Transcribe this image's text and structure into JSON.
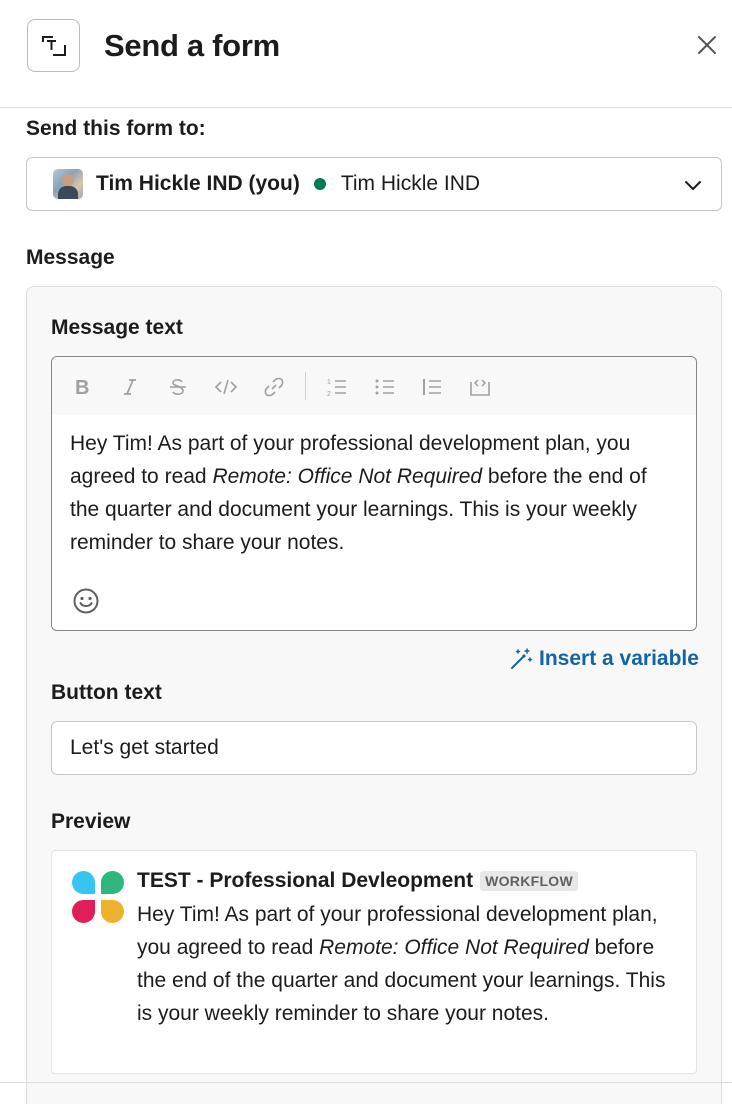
{
  "header": {
    "title": "Send a form",
    "icon": "form-icon",
    "close_icon": "close-icon"
  },
  "recipient": {
    "label": "Send this form to:",
    "name": "Tim Hickle IND (you)",
    "alt_name": "Tim Hickle IND",
    "presence_color": "#007a5a"
  },
  "message": {
    "section_label": "Message",
    "text_label": "Message text",
    "toolbar": [
      "bold-icon",
      "italic-icon",
      "strikethrough-icon",
      "code-icon",
      "link-icon",
      "ordered-list-icon",
      "bulleted-list-icon",
      "quote-icon",
      "code-block-icon"
    ],
    "body": {
      "part1": "Hey Tim! As part of your professional development plan, you agreed to read ",
      "emphasis": "Remote: Office Not Required",
      "part2": " before the end of the quarter and document your learnings. This is your weekly reminder to share your notes."
    },
    "insert_variable": "Insert a variable",
    "button_text_label": "Button text",
    "button_text_value": "Let's get started",
    "preview_label": "Preview"
  },
  "preview": {
    "title": "TEST - Professional Devleopment",
    "badge": "WORKFLOW",
    "body": {
      "part1": "Hey Tim! As part of your professional development plan, you agreed to read ",
      "emphasis": "Remote: Office Not Required",
      "part2": " before the end of the quarter and document your learnings. This is your weekly reminder to share your notes."
    },
    "logo_colors": [
      "#36c5f0",
      "#2eb67d",
      "#e01e5a",
      "#ecb22e"
    ]
  },
  "colors": {
    "link": "#1264a3",
    "text": "#1d1c1d",
    "border": "#dddddd"
  }
}
